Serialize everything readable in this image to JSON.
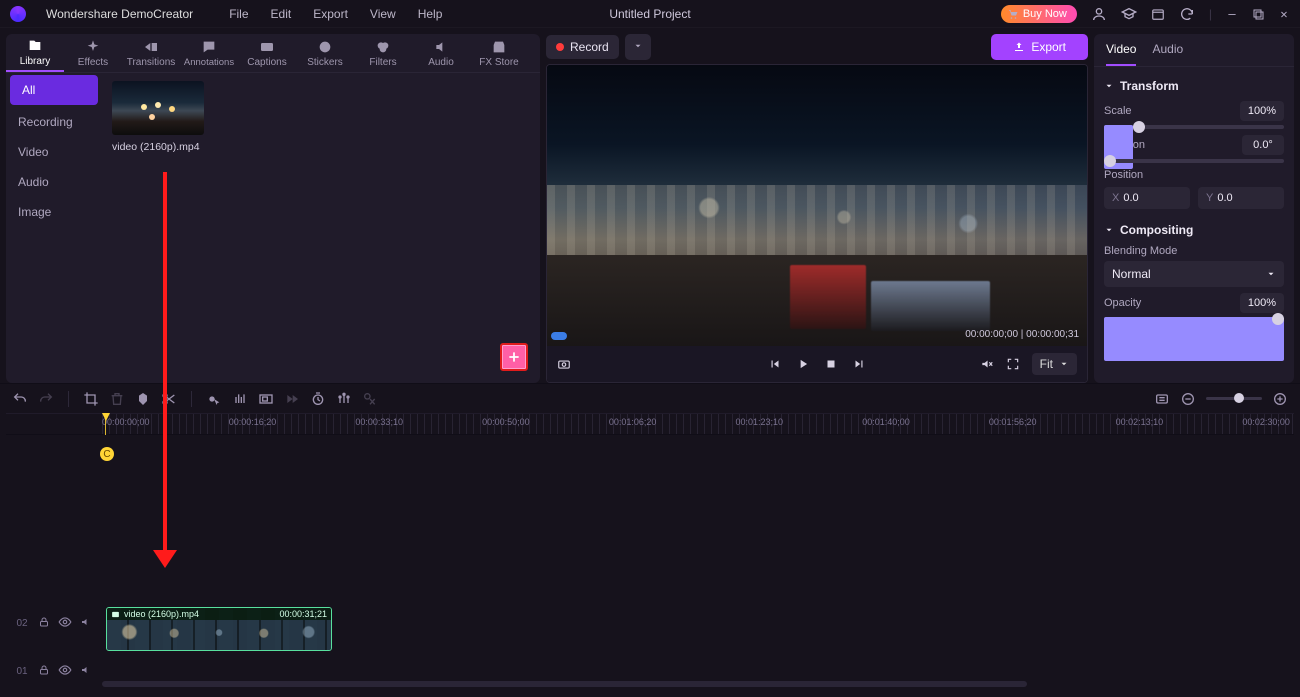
{
  "app": {
    "name": "Wondershare DemoCreator",
    "project_title": "Untitled Project"
  },
  "menu": [
    "File",
    "Edit",
    "Export",
    "View",
    "Help"
  ],
  "title_actions": {
    "buy_now": "Buy Now"
  },
  "library": {
    "tabs": [
      "Library",
      "Effects",
      "Transitions",
      "Annotations",
      "Captions",
      "Stickers",
      "Filters",
      "Audio",
      "FX Store"
    ],
    "active_tab": 0,
    "sidebar": [
      "All",
      "Recording",
      "Video",
      "Audio",
      "Image"
    ],
    "active_side": 0,
    "clips": [
      {
        "name": "video (2160p).mp4"
      }
    ]
  },
  "record": {
    "label": "Record"
  },
  "export": {
    "label": "Export"
  },
  "preview": {
    "current_time": "00:00:00;00",
    "total_time": "00:00:00;31",
    "fit_label": "Fit"
  },
  "properties": {
    "tabs": [
      "Video",
      "Audio"
    ],
    "active": 0,
    "transform": {
      "title": "Transform",
      "scale_label": "Scale",
      "scale_value": "100%",
      "rotation_label": "Rotation",
      "rotation_value": "0.0°",
      "position_label": "Position",
      "pos_x": "0.0",
      "pos_y": "0.0"
    },
    "compositing": {
      "title": "Compositing",
      "blend_label": "Blending Mode",
      "blend_value": "Normal",
      "opacity_label": "Opacity",
      "opacity_value": "100%"
    }
  },
  "ruler_labels": [
    "00:00:00;00",
    "00:00:16;20",
    "00:00:33;10",
    "00:00:50;00",
    "00:01:06;20",
    "00:01:23;10",
    "00:01:40;00",
    "00:01:56;20",
    "00:02:13;10",
    "00:02:30;00"
  ],
  "timeline": {
    "tracks": [
      {
        "idx": "02"
      },
      {
        "idx": "01"
      }
    ],
    "clip": {
      "name": "video (2160p).mp4",
      "duration": "00:00:31;21"
    },
    "marker": "C"
  }
}
